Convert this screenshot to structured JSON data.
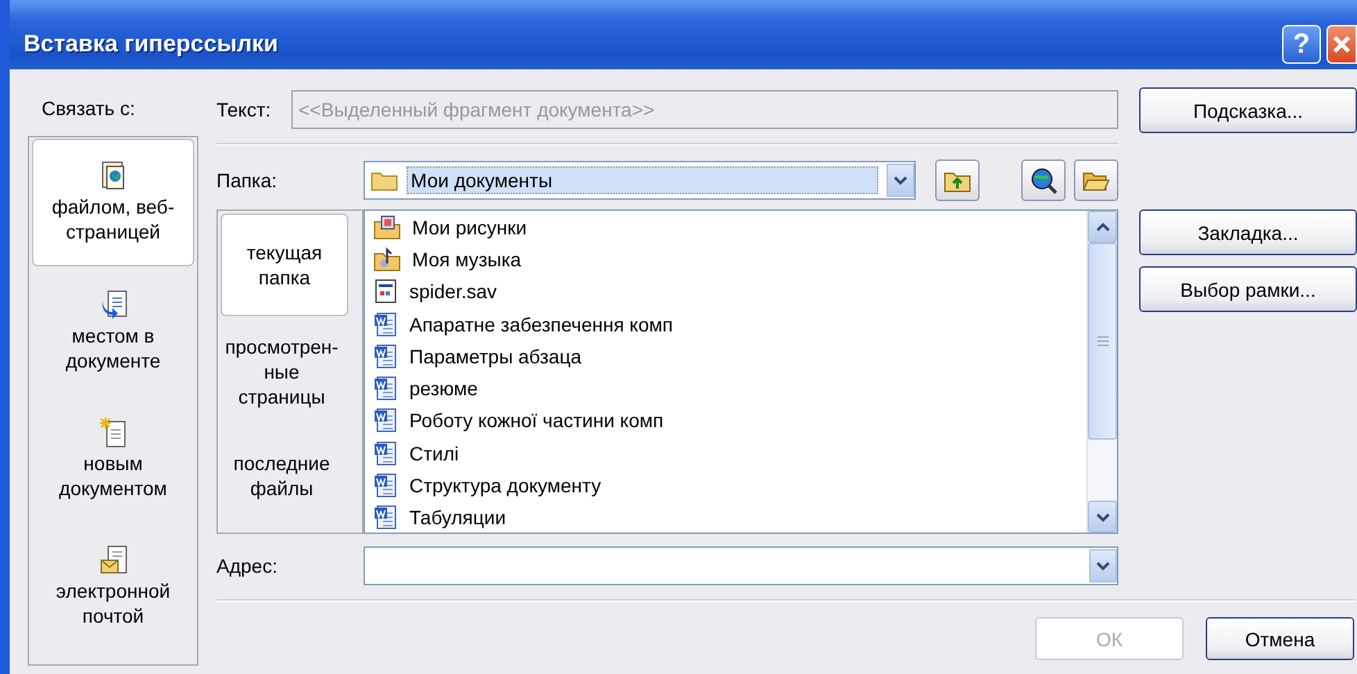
{
  "window": {
    "title": "Вставка гиперссылки",
    "help_button": "?"
  },
  "link_to": {
    "label": "Связать с:",
    "items": [
      {
        "label": "файлом, веб-страницей",
        "kind": "file",
        "selected": true
      },
      {
        "label": "местом в документе",
        "kind": "place",
        "selected": false
      },
      {
        "label": "новым документом",
        "kind": "new",
        "selected": false
      },
      {
        "label": "электронной почтой",
        "kind": "email",
        "selected": false
      }
    ]
  },
  "text_field": {
    "label": "Текст:",
    "value": "<<Выделенный фрагмент документа>>",
    "disabled": true
  },
  "folder": {
    "label": "Папка:",
    "value": "Мои документы"
  },
  "browse_tabs": [
    {
      "label": "текущая папка",
      "selected": true
    },
    {
      "label": "просмотрен-ные страницы",
      "selected": false
    },
    {
      "label": "последние файлы",
      "selected": false
    }
  ],
  "files": [
    {
      "name": "Мои рисунки",
      "kind": "pictures"
    },
    {
      "name": "Моя музыка",
      "kind": "music"
    },
    {
      "name": "spider.sav",
      "kind": "app"
    },
    {
      "name": "Апаратне забезпечення комп",
      "kind": "doc"
    },
    {
      "name": "Параметры абзаца",
      "kind": "doc"
    },
    {
      "name": "резюме",
      "kind": "doc"
    },
    {
      "name": "Роботу кожної частини комп",
      "kind": "doc"
    },
    {
      "name": "Стилі",
      "kind": "doc"
    },
    {
      "name": "Структура документу",
      "kind": "doc"
    },
    {
      "name": "Табуляции",
      "kind": "doc"
    }
  ],
  "address": {
    "label": "Адрес:"
  },
  "side_buttons": [
    "Подсказка...",
    "Закладка...",
    "Выбор рамки..."
  ],
  "ok_button": {
    "label": "ОК",
    "disabled": true
  },
  "cancel_button": {
    "label": "Отмена",
    "disabled": false
  }
}
